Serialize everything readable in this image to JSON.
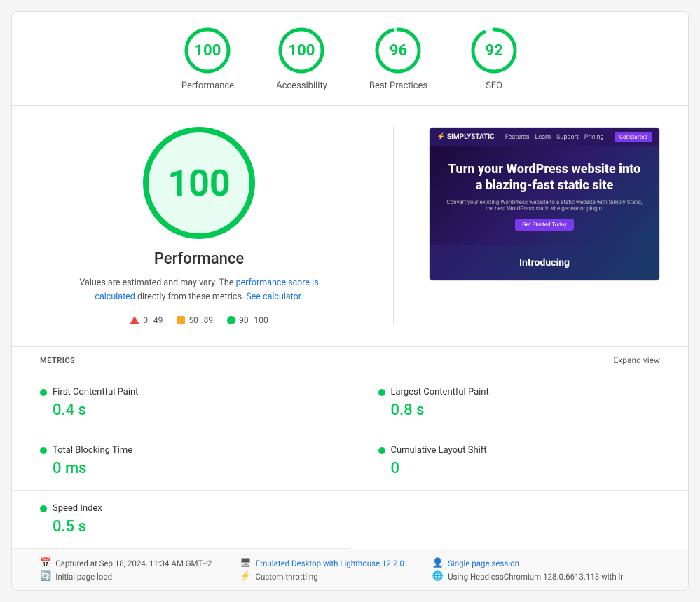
{
  "scores": [
    {
      "id": "performance",
      "value": 100,
      "label": "Performance",
      "color": "#00c853",
      "radius": 30,
      "circumference": 188.5
    },
    {
      "id": "accessibility",
      "value": 100,
      "label": "Accessibility",
      "color": "#00c853",
      "radius": 30,
      "circumference": 188.5
    },
    {
      "id": "best-practices",
      "value": 96,
      "label": "Best Practices",
      "color": "#00c853",
      "radius": 30,
      "circumference": 188.5
    },
    {
      "id": "seo",
      "value": 92,
      "label": "SEO",
      "color": "#00c853",
      "radius": 30,
      "circumference": 188.5
    }
  ],
  "big_score": {
    "value": "100",
    "label": "Performance"
  },
  "description": {
    "text_before": "Values are estimated and may vary. The ",
    "link_text": "performance score is calculated",
    "link_text2": "See calculator.",
    "text_after": " directly from these metrics. "
  },
  "legend": [
    {
      "type": "triangle",
      "range": "0–49",
      "color": "#f44336"
    },
    {
      "type": "square",
      "range": "50–89",
      "color": "#f9a825"
    },
    {
      "type": "dot",
      "range": "90–100",
      "color": "#00c853"
    }
  ],
  "screenshot": {
    "logo": "SIMPLYSTATIC",
    "nav_links": [
      "Features",
      "Learn",
      "Support",
      "Pricing"
    ],
    "cta_button": "Get Started",
    "hero_title": "Turn your WordPress website into a blazing-fast static site",
    "sub_text": "Convert your existing WordPress website to a static website with Simply Static, the best WordPress static site generator plugin.",
    "hero_cta": "Get Started Today",
    "intro_text": "Introducing"
  },
  "metrics": {
    "section_label": "METRICS",
    "expand_label": "Expand view",
    "items": [
      {
        "name": "First Contentful Paint",
        "value": "0.4 s",
        "color": "#00c853"
      },
      {
        "name": "Largest Contentful Paint",
        "value": "0.8 s",
        "color": "#00c853"
      },
      {
        "name": "Total Blocking Time",
        "value": "0 ms",
        "color": "#00c853"
      },
      {
        "name": "Cumulative Layout Shift",
        "value": "0",
        "color": "#00c853"
      },
      {
        "name": "Speed Index",
        "value": "0.5 s",
        "color": "#00c853"
      }
    ]
  },
  "footer": {
    "col1": [
      {
        "icon": "📅",
        "text": "Captured at Sep 18, 2024, 11:34 AM GMT+2"
      },
      {
        "icon": "🔄",
        "text": "Initial page load"
      }
    ],
    "col2": [
      {
        "icon": "🖥",
        "text": "Emulated Desktop with Lighthouse 12.2.0",
        "is_link": true
      },
      {
        "icon": "⚡",
        "text": "Custom throttling",
        "is_link": false
      }
    ],
    "col3": [
      {
        "icon": "👤",
        "text": "Single page session",
        "is_link": true
      },
      {
        "icon": "🌐",
        "text": "Using HeadlessChromium 128.0.6613.113 with lr",
        "is_link": false
      }
    ]
  }
}
